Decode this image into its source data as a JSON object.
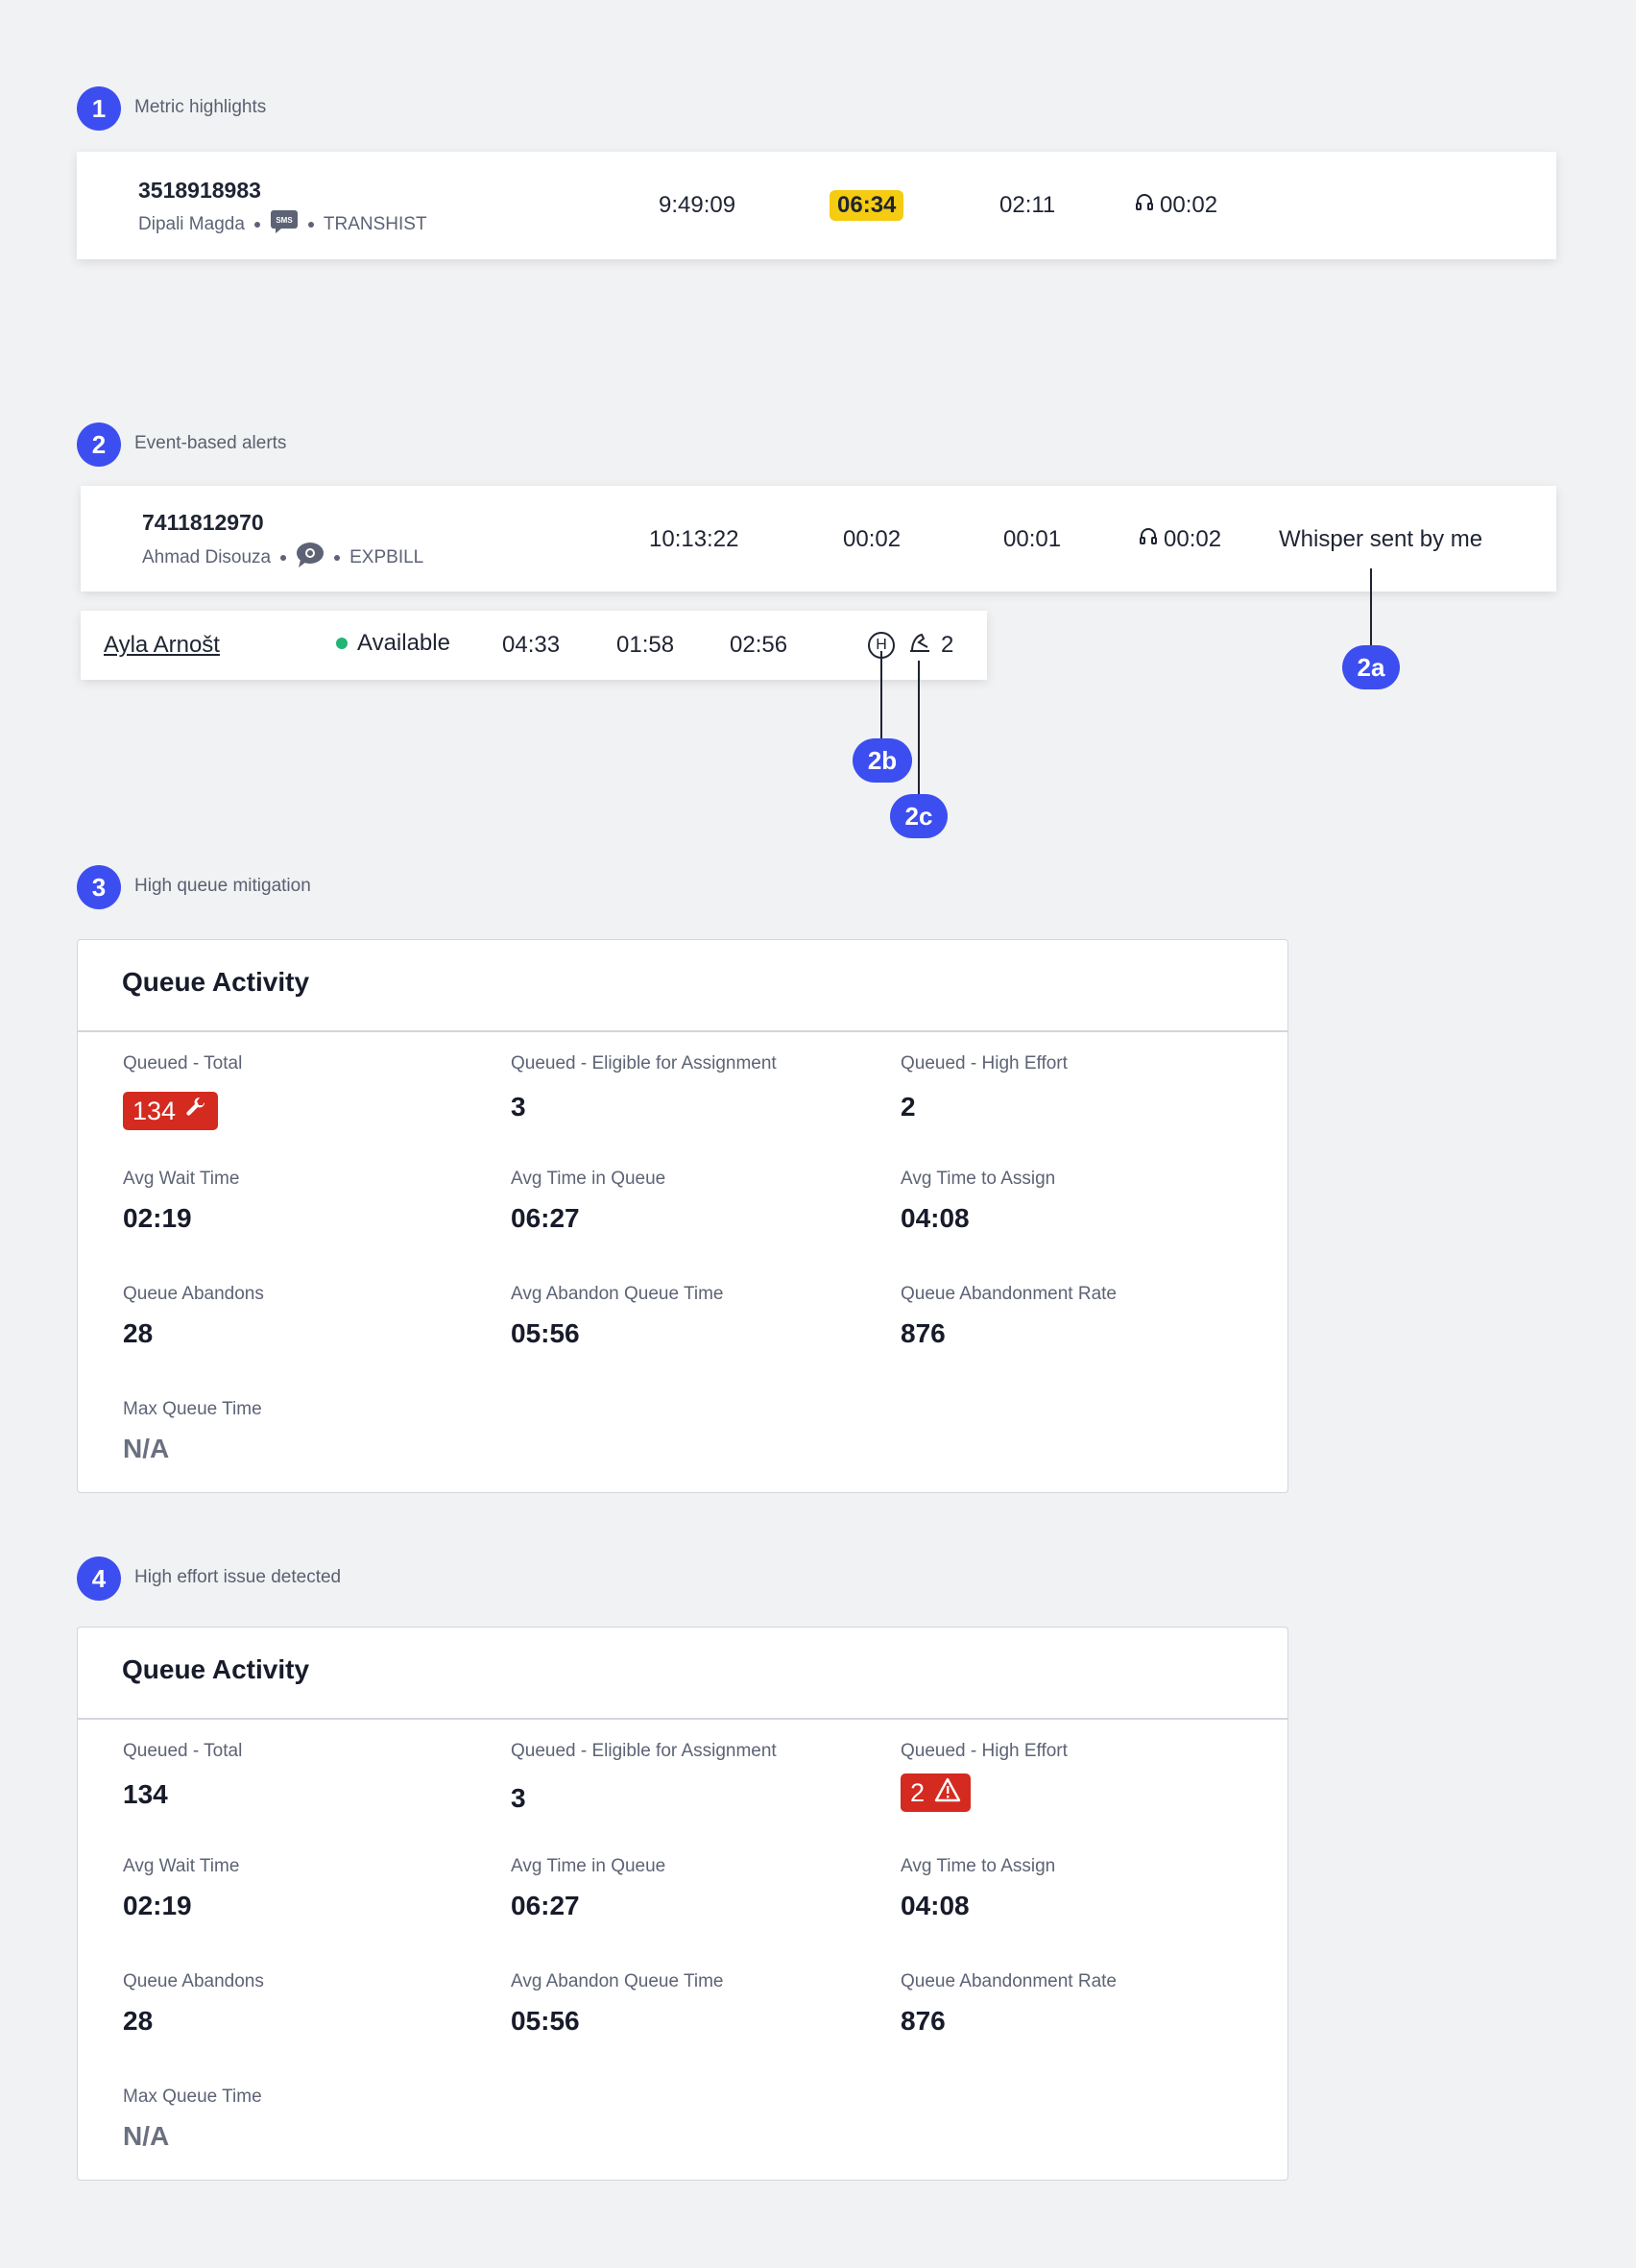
{
  "colors": {
    "accent": "#3d4ef0",
    "highlight": "#f5cc12",
    "alert": "#d42a1f",
    "available": "#22b573"
  },
  "s1": {
    "num": "1",
    "label": "Metric highlights",
    "phone": "3518918983",
    "name": "Dipali Magda",
    "channel_icon": "sms-icon",
    "queue": "TRANSHIST",
    "t1": "9:49:09",
    "t2": "06:34",
    "t3": "02:11",
    "t4": "00:02"
  },
  "s2": {
    "num": "2",
    "label": "Event-based alerts",
    "phone": "7411812970",
    "name": "Ahmad Disouza",
    "channel_icon": "apple-messages-icon",
    "queue": "EXPBILL",
    "t1": "10:13:22",
    "t2": "00:02",
    "t3": "00:01",
    "t4": "00:02",
    "whisper": "Whisper sent by me",
    "agent": {
      "name": "Ayla Arnošt",
      "status": "Available",
      "t1": "04:33",
      "t2": "01:58",
      "t3": "02:56",
      "h_icon": "H",
      "count": "2"
    },
    "callouts": {
      "a": "2a",
      "b": "2b",
      "c": "2c"
    }
  },
  "s3": {
    "num": "3",
    "label": "High queue mitigation",
    "title": "Queue Activity",
    "metrics": [
      {
        "label": "Queued  - Total",
        "value": "134"
      },
      {
        "label": "Queued - Eligible for Assignment",
        "value": "3"
      },
      {
        "label": "Queued - High Effort",
        "value": "2"
      },
      {
        "label": "Avg Wait Time",
        "value": "02:19"
      },
      {
        "label": "Avg Time in Queue",
        "value": "06:27"
      },
      {
        "label": "Avg Time to Assign",
        "value": "04:08"
      },
      {
        "label": "Queue Abandons",
        "value": "28"
      },
      {
        "label": "Avg Abandon Queue Time",
        "value": "05:56"
      },
      {
        "label": "Queue Abandonment Rate",
        "value": "876"
      },
      {
        "label": "Max Queue Time",
        "value": "N/A"
      }
    ]
  },
  "s4": {
    "num": "4",
    "label": "High effort issue detected",
    "title": "Queue Activity",
    "metrics": [
      {
        "label": "Queued - Total",
        "value": "134"
      },
      {
        "label": "Queued - Eligible for Assignment",
        "value": "3"
      },
      {
        "label": "Queued - High Effort",
        "value": "2"
      },
      {
        "label": "Avg Wait Time",
        "value": "02:19"
      },
      {
        "label": "Avg Time in Queue",
        "value": "06:27"
      },
      {
        "label": "Avg Time to Assign",
        "value": "04:08"
      },
      {
        "label": "Queue Abandons",
        "value": "28"
      },
      {
        "label": "Avg Abandon Queue Time",
        "value": "05:56"
      },
      {
        "label": "Queue Abandonment Rate",
        "value": "876"
      },
      {
        "label": "Max Queue Time",
        "value": "N/A"
      }
    ]
  }
}
